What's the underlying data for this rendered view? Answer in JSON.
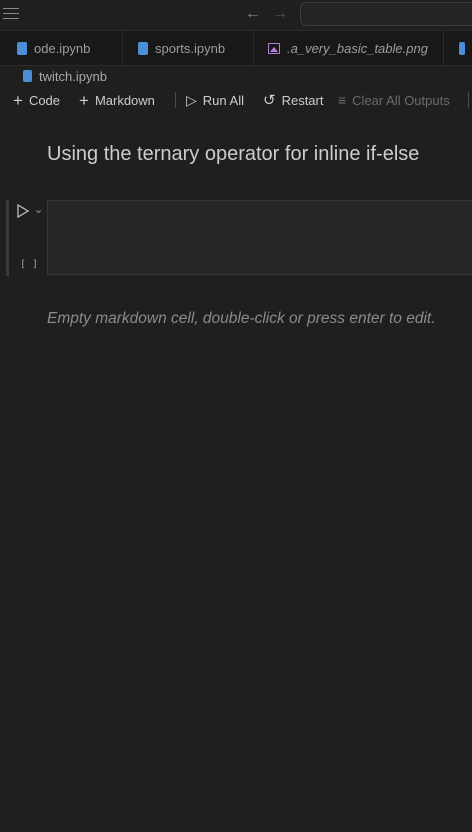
{
  "tabs": [
    {
      "label": "ode.ipynb",
      "icon": "notebook-icon"
    },
    {
      "label": "sports.ipynb",
      "icon": "notebook-icon"
    },
    {
      "label": ".a_very_basic_table.png",
      "icon": "image-icon"
    }
  ],
  "breadcrumb": {
    "file": "twitch.ipynb"
  },
  "toolbar": {
    "code_label": "Code",
    "markdown_label": "Markdown",
    "run_all_label": "Run All",
    "restart_label": "Restart",
    "clear_outputs_label": "Clear All Outputs"
  },
  "cells": {
    "heading_text": "Using the ternary operator for inline if-else",
    "code_exec_count": "[ ]",
    "empty_markdown_text": "Empty markdown cell, double-click or press enter to edit."
  },
  "colors": {
    "background": "#1f1f1f",
    "notebook_icon": "#4a8fd8",
    "image_icon": "#b480d6"
  }
}
